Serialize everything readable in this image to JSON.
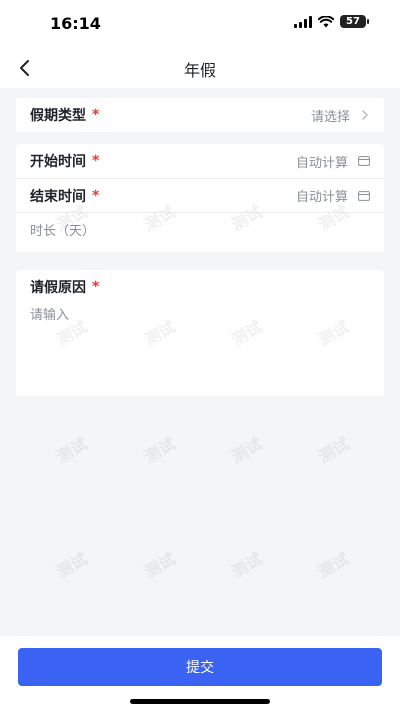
{
  "status": {
    "time": "16:14",
    "battery": "57"
  },
  "nav": {
    "title": "年假"
  },
  "form": {
    "leave_type": {
      "label": "假期类型",
      "required_mark": "*",
      "value": "请选择"
    },
    "start_time": {
      "label": "开始时间",
      "required_mark": "*",
      "value": "自动计算"
    },
    "end_time": {
      "label": "结束时间",
      "required_mark": "*",
      "value": "自动计算"
    },
    "duration": {
      "label": "时长（天）"
    },
    "reason": {
      "label": "请假原因",
      "required_mark": "*",
      "placeholder": "请输入"
    }
  },
  "watermark": {
    "text": "测试"
  },
  "actions": {
    "submit_label": "提交"
  },
  "colors": {
    "primary": "#3a63f3",
    "required": "#e53935"
  }
}
